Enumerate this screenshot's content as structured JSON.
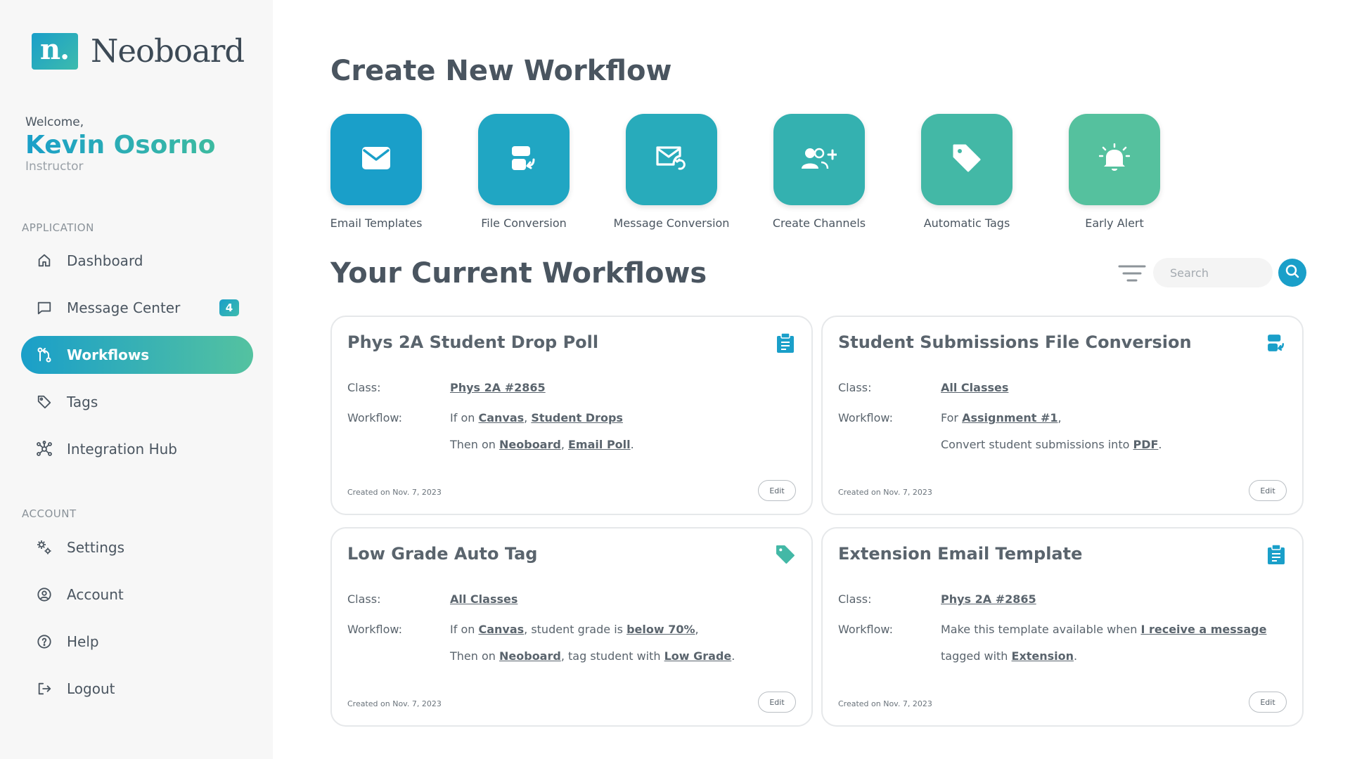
{
  "brand": {
    "logo_mark": "n.",
    "name": "Neoboard"
  },
  "user": {
    "welcome": "Welcome,",
    "name": "Kevin Osorno",
    "role": "Instructor"
  },
  "sidebar": {
    "application_label": "APPLICATION",
    "account_label": "ACCOUNT",
    "app_items": [
      {
        "label": "Dashboard",
        "icon": "home-icon"
      },
      {
        "label": "Message Center",
        "icon": "chat-icon",
        "badge": "4"
      },
      {
        "label": "Workflows",
        "icon": "workflow-icon",
        "active": true
      },
      {
        "label": "Tags",
        "icon": "tag-icon"
      },
      {
        "label": "Integration Hub",
        "icon": "hub-icon"
      }
    ],
    "account_items": [
      {
        "label": "Settings",
        "icon": "gear-icon"
      },
      {
        "label": "Account",
        "icon": "user-circle-icon"
      },
      {
        "label": "Help",
        "icon": "help-icon"
      },
      {
        "label": "Logout",
        "icon": "logout-icon"
      }
    ]
  },
  "create": {
    "title": "Create New Workflow",
    "tiles": [
      {
        "label": "Email Templates",
        "icon": "envelope-icon",
        "color": "#1a9fc9"
      },
      {
        "label": "File Conversion",
        "icon": "file-convert-icon",
        "color": "#20a6c3"
      },
      {
        "label": "Message Conversion",
        "icon": "message-convert-icon",
        "color": "#28abbb"
      },
      {
        "label": "Create Channels",
        "icon": "add-users-icon",
        "color": "#34b1b0"
      },
      {
        "label": "Automatic Tags",
        "icon": "tag-icon",
        "color": "#43b8a6"
      },
      {
        "label": "Early Alert",
        "icon": "bell-icon",
        "color": "#55c19e"
      }
    ]
  },
  "current": {
    "title": "Your Current Workflows",
    "search_placeholder": "Search"
  },
  "cards": [
    {
      "title": "Phys 2A Student Drop Poll",
      "icon": "clipboard-icon",
      "class_label": "Class:",
      "class_value": "Phys 2A #2865",
      "workflow_label": "Workflow:",
      "line1": {
        "p1": "If on ",
        "l1": "Canvas",
        "p2": ", ",
        "l2": "Student Drops",
        "p3": ""
      },
      "line2": {
        "p1": "Then on ",
        "l1": "Neoboard",
        "p2": ", ",
        "l2": "Email Poll",
        "p3": "."
      },
      "created": "Created on Nov. 7, 2023",
      "edit": "Edit"
    },
    {
      "title": "Student Submissions File Conversion",
      "icon": "file-convert-icon",
      "class_label": "Class:",
      "class_value": "All Classes",
      "workflow_label": "Workflow:",
      "line1": {
        "p1": "For ",
        "l1": "Assignment #1",
        "p2": ",",
        "l2": "",
        "p3": ""
      },
      "line2": {
        "p1": "Convert student submissions into ",
        "l1": "PDF",
        "p2": ".",
        "l2": "",
        "p3": ""
      },
      "created": "Created on Nov. 7, 2023",
      "edit": "Edit"
    },
    {
      "title": "Low Grade Auto Tag",
      "icon": "tag-icon",
      "class_label": "Class:",
      "class_value": "All Classes",
      "workflow_label": "Workflow:",
      "line1": {
        "p1": "If on ",
        "l1": "Canvas",
        "p2": ", student grade is ",
        "l2": "below 70%",
        "p3": ","
      },
      "line2": {
        "p1": "Then on ",
        "l1": "Neoboard",
        "p2": ", tag student with ",
        "l2": "Low Grade",
        "p3": "."
      },
      "created": "Created on Nov. 7, 2023",
      "edit": "Edit"
    },
    {
      "title": "Extension Email Template",
      "icon": "clipboard-icon",
      "class_label": "Class:",
      "class_value": "Phys 2A #2865",
      "workflow_label": "Workflow:",
      "line1": {
        "p1": "Make this template available when ",
        "l1": "I receive a message",
        "p2": "",
        "l2": "",
        "p3": ""
      },
      "line2": {
        "p1": "tagged with ",
        "l1": "Extension",
        "p2": ".",
        "l2": "",
        "p3": ""
      },
      "created": "Created on Nov. 7, 2023",
      "edit": "Edit"
    }
  ]
}
